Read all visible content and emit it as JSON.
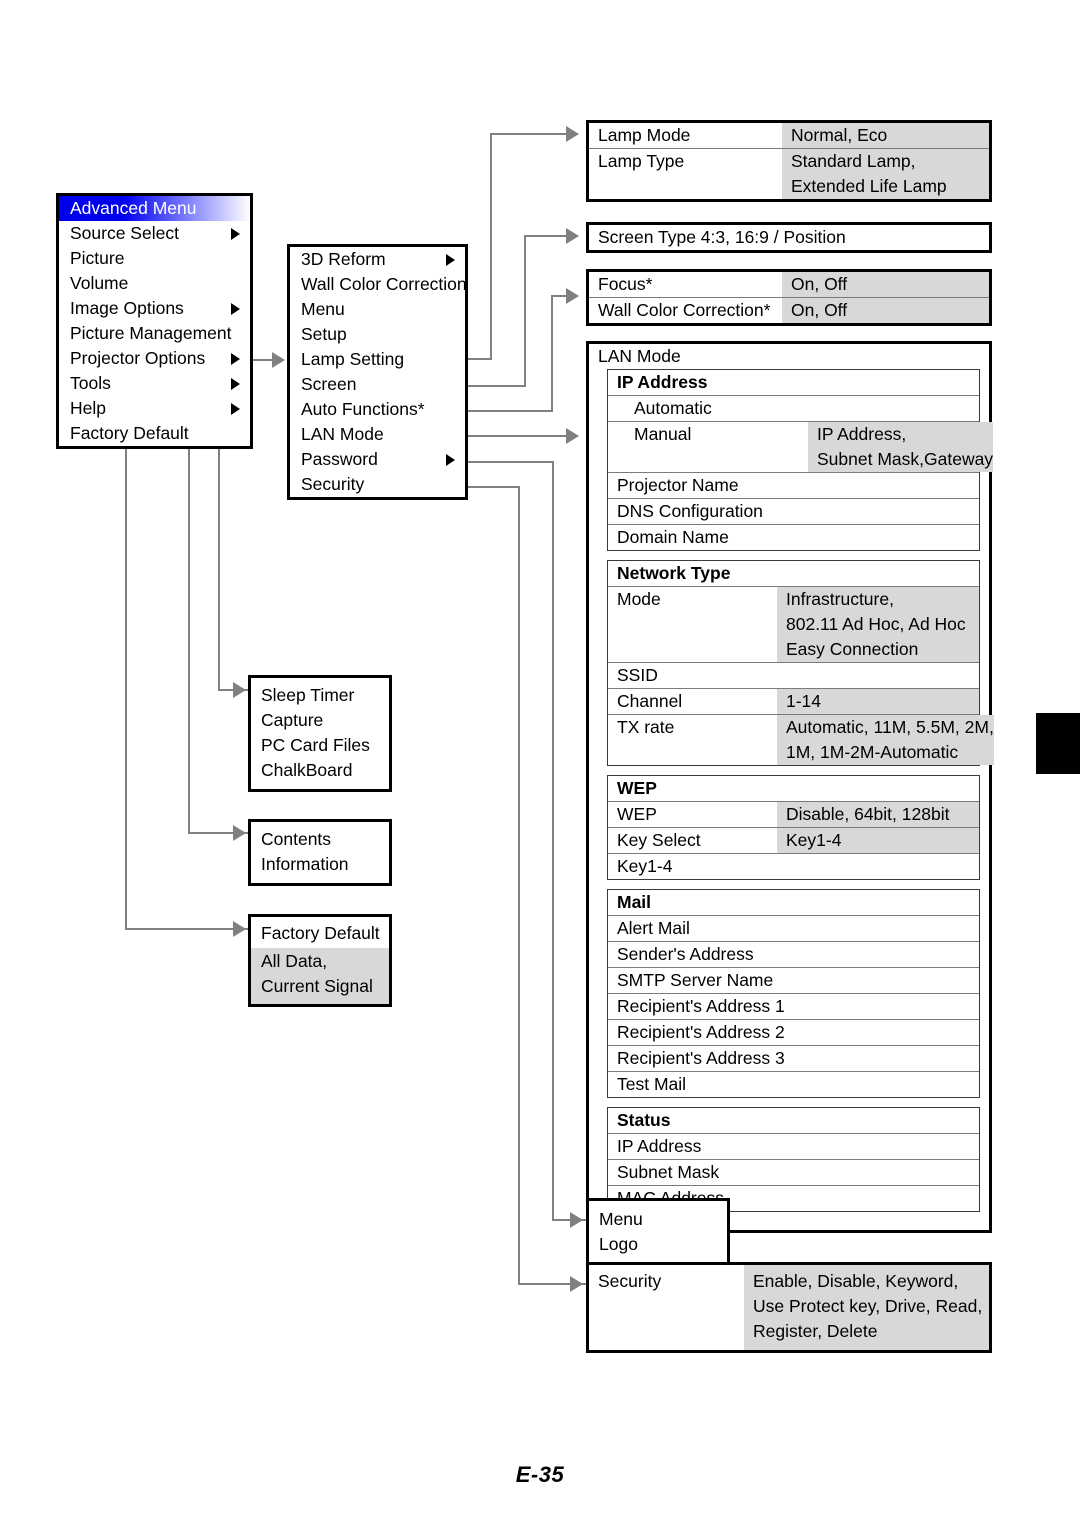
{
  "page": {
    "footer": "E-35"
  },
  "advanced_menu": {
    "title": "Advanced Menu",
    "items": [
      {
        "label": "Source Select",
        "caret": true
      },
      {
        "label": "Picture",
        "caret": false
      },
      {
        "label": "Volume",
        "caret": false
      },
      {
        "label": "Image Options",
        "caret": true
      },
      {
        "label": "Picture Management",
        "caret": false
      },
      {
        "label": "Projector Options",
        "caret": true
      },
      {
        "label": "Tools",
        "caret": true
      },
      {
        "label": "Help",
        "caret": true
      },
      {
        "label": "Factory Default",
        "caret": false
      }
    ]
  },
  "projector_options_menu": {
    "items": [
      {
        "label": "3D Reform",
        "caret": true
      },
      {
        "label": "Wall Color Correction",
        "caret": false
      },
      {
        "label": "Menu",
        "caret": false
      },
      {
        "label": "Setup",
        "caret": false
      },
      {
        "label": "Lamp Setting",
        "caret": false
      },
      {
        "label": "Screen",
        "caret": false
      },
      {
        "label": "Auto Functions*",
        "caret": false
      },
      {
        "label": "LAN Mode",
        "caret": false
      },
      {
        "label": "Password",
        "caret": true
      },
      {
        "label": "Security",
        "caret": false
      }
    ]
  },
  "lamp_setting_table": {
    "rows": [
      {
        "label": "Lamp Mode",
        "values": [
          "Normal, Eco"
        ]
      },
      {
        "label": "Lamp Type",
        "values": [
          "Standard Lamp,",
          "Extended Life Lamp"
        ]
      }
    ]
  },
  "screen_table": {
    "text": "Screen Type 4:3, 16:9 / Position"
  },
  "auto_functions_table": {
    "rows": [
      {
        "label": "Focus*",
        "values": [
          "On, Off"
        ]
      },
      {
        "label": "Wall Color Correction*",
        "values": [
          "On, Off"
        ]
      }
    ]
  },
  "lan_mode": {
    "title": "LAN Mode",
    "groups": [
      {
        "heading": "IP Address",
        "rows": [
          {
            "label": "Automatic",
            "indent": true,
            "values": []
          },
          {
            "label": "Manual",
            "indent": true,
            "values": [
              "IP Address,",
              "Subnet Mask,Gateway"
            ]
          },
          {
            "label": "Projector Name",
            "indent": false,
            "values": []
          },
          {
            "label": "DNS Configuration",
            "indent": false,
            "values": []
          },
          {
            "label": "Domain Name",
            "indent": false,
            "values": []
          }
        ]
      },
      {
        "heading": "Network Type",
        "rows": [
          {
            "label": "Mode",
            "indent": false,
            "values": [
              "Infrastructure,",
              "802.11 Ad Hoc, Ad Hoc",
              "Easy Connection"
            ]
          },
          {
            "label": "SSID",
            "indent": false,
            "values": []
          },
          {
            "label": "Channel",
            "indent": false,
            "values": [
              "1-14"
            ]
          },
          {
            "label": "TX rate",
            "indent": false,
            "values": [
              "Automatic, 11M, 5.5M, 2M,",
              "1M, 1M-2M-Automatic"
            ]
          }
        ]
      },
      {
        "heading": "WEP",
        "rows": [
          {
            "label": "WEP",
            "indent": false,
            "values": [
              "Disable, 64bit, 128bit"
            ]
          },
          {
            "label": "Key Select",
            "indent": false,
            "values": [
              "Key1-4"
            ]
          },
          {
            "label": "Key1-4",
            "indent": false,
            "values": []
          }
        ]
      },
      {
        "heading": "Mail",
        "rows": [
          {
            "label": "Alert Mail",
            "indent": false,
            "values": []
          },
          {
            "label": "Sender's Address",
            "indent": false,
            "values": []
          },
          {
            "label": "SMTP Server Name",
            "indent": false,
            "values": []
          },
          {
            "label": "Recipient's Address 1",
            "indent": false,
            "values": []
          },
          {
            "label": "Recipient's Address 2",
            "indent": false,
            "values": []
          },
          {
            "label": "Recipient's Address 3",
            "indent": false,
            "values": []
          },
          {
            "label": "Test Mail",
            "indent": false,
            "values": []
          }
        ]
      },
      {
        "heading": "Status",
        "rows": [
          {
            "label": "IP Address",
            "indent": false,
            "values": []
          },
          {
            "label": "Subnet Mask",
            "indent": false,
            "values": []
          },
          {
            "label": "MAC Address",
            "indent": false,
            "values": []
          }
        ]
      }
    ]
  },
  "tools_box": {
    "items": [
      "Sleep Timer",
      "Capture",
      "PC Card Files",
      "ChalkBoard"
    ]
  },
  "help_box": {
    "items": [
      "Contents",
      "Information"
    ]
  },
  "factory_default_box": {
    "title": "Factory Default",
    "values": [
      "All Data,",
      "Current Signal"
    ]
  },
  "password_box": {
    "items": [
      "Menu",
      "Logo"
    ]
  },
  "security_box": {
    "label": "Security",
    "values": [
      "Enable, Disable, Keyword,",
      "Use Protect key, Drive, Read,",
      "Register, Delete"
    ]
  }
}
